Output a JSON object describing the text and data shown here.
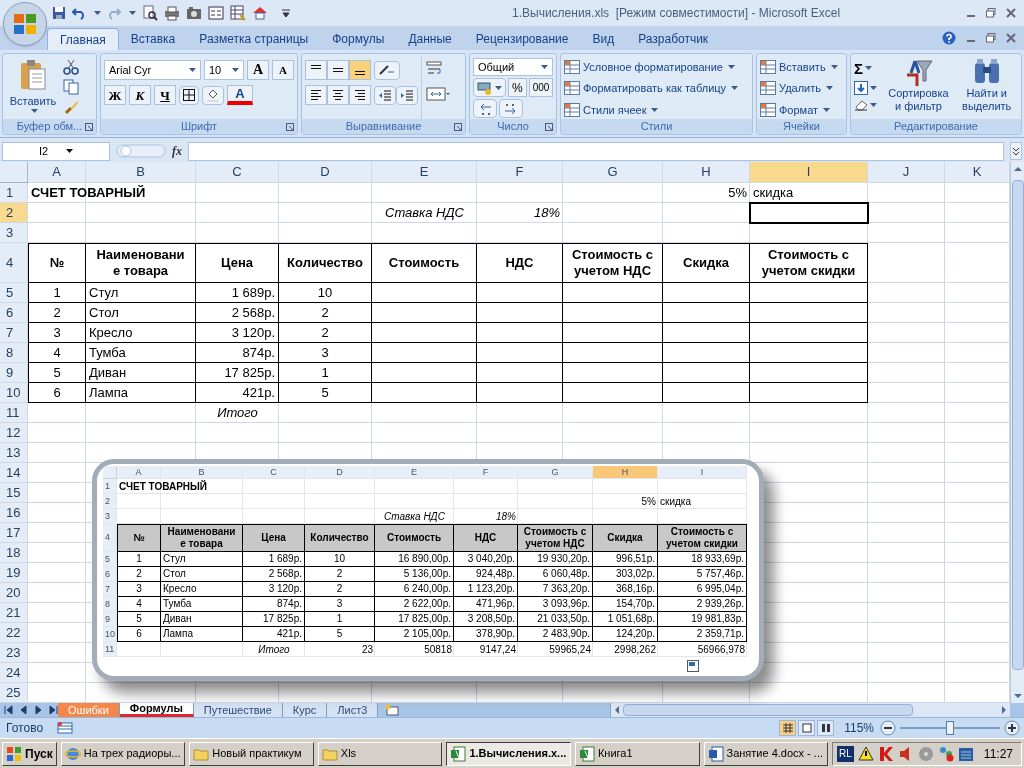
{
  "window": {
    "title": "1.Вычисления.xls  [Режим совместимости] - Microsoft Excel"
  },
  "ribbon": {
    "tabs": [
      {
        "label": "Главная",
        "selected": true
      },
      {
        "label": "Вставка",
        "selected": false
      },
      {
        "label": "Разметка страницы",
        "selected": false
      },
      {
        "label": "Формулы",
        "selected": false
      },
      {
        "label": "Данные",
        "selected": false
      },
      {
        "label": "Рецензирование",
        "selected": false
      },
      {
        "label": "Вид",
        "selected": false
      },
      {
        "label": "Разработчик",
        "selected": false
      }
    ],
    "groups": [
      {
        "kind": "clipboard",
        "label": "Буфер обм...",
        "paste": "Вставить"
      },
      {
        "kind": "font",
        "label": "Шрифт",
        "font_name": "Arial Cyr",
        "font_size": "10",
        "grow": "A",
        "shrink": "A",
        "bold": "Ж",
        "italic": "К",
        "underline": "Ч",
        "font_color": "A"
      },
      {
        "kind": "alignment",
        "label": "Выравнивание",
        "vertical_align": [
          {
            "selected": false
          },
          {
            "selected": false
          },
          {
            "selected": true
          }
        ]
      },
      {
        "kind": "number",
        "label": "Число",
        "format": "Общий",
        "percent": "%",
        "thousands": "000"
      },
      {
        "kind": "list",
        "label": "Стили",
        "items": [
          "Условное форматирование",
          "Форматировать как таблицу",
          "Стили ячеек"
        ]
      },
      {
        "kind": "list",
        "label": "Ячейки",
        "items": [
          "Вставить",
          "Удалить",
          "Формат"
        ]
      },
      {
        "kind": "editing",
        "label": "Редактирование",
        "sum": "Σ",
        "sort": "Сортировка и фильтр",
        "find": "Найти и выделить"
      }
    ]
  },
  "formula_bar": {
    "name_box": "I2",
    "fx": "fx"
  },
  "sheet": {
    "columns": [
      {
        "label": "A",
        "selected": false
      },
      {
        "label": "B",
        "selected": false
      },
      {
        "label": "C",
        "selected": false
      },
      {
        "label": "D",
        "selected": false
      },
      {
        "label": "E",
        "selected": false
      },
      {
        "label": "F",
        "selected": false
      },
      {
        "label": "G",
        "selected": false
      },
      {
        "label": "H",
        "selected": false
      },
      {
        "label": "I",
        "selected": true
      },
      {
        "label": "J",
        "selected": false
      },
      {
        "label": "K",
        "selected": false
      }
    ],
    "rows": [
      {
        "number": "1",
        "selected": false,
        "kind": "text",
        "cells": [
          "СЧЕТ ТОВАРНЫЙ",
          null,
          null,
          null,
          null,
          null,
          null,
          "5%",
          "скидка"
        ]
      },
      {
        "number": "2",
        "selected": true,
        "kind": "text",
        "cells": [
          null,
          null,
          null,
          null,
          "Ставка НДС",
          "18%"
        ]
      },
      {
        "number": "3",
        "selected": false,
        "kind": "text"
      },
      {
        "number": "4",
        "selected": false,
        "kind": "header",
        "cells": [
          "№",
          "Наименовани\nе товара",
          "Цена",
          "Количество",
          "Стоимость",
          "НДС",
          "Стоимость с\nучетом НДС",
          "Скидка",
          "Стоимость с\nучетом скидки"
        ]
      },
      {
        "number": "5",
        "selected": false,
        "kind": "item",
        "cells": [
          "1",
          "Стул",
          "1 689р.",
          "10"
        ]
      },
      {
        "number": "6",
        "selected": false,
        "kind": "item",
        "cells": [
          "2",
          "Стол",
          "2 568р.",
          "2"
        ]
      },
      {
        "number": "7",
        "selected": false,
        "kind": "item",
        "cells": [
          "3",
          "Кресло",
          "3 120р.",
          "2"
        ]
      },
      {
        "number": "8",
        "selected": false,
        "kind": "item",
        "cells": [
          "4",
          "Тумба",
          "874р.",
          "3"
        ]
      },
      {
        "number": "9",
        "selected": false,
        "kind": "item",
        "cells": [
          "5",
          "Диван",
          "17 825р.",
          "1"
        ]
      },
      {
        "number": "10",
        "selected": false,
        "kind": "item",
        "cells": [
          "6",
          "Лампа",
          "421р.",
          "5"
        ]
      },
      {
        "number": "11",
        "selected": false,
        "kind": "total",
        "cells": [
          null,
          null,
          "Итого"
        ]
      },
      {
        "number": "12",
        "selected": false,
        "kind": "text"
      },
      {
        "number": "13",
        "selected": false,
        "kind": "text"
      },
      {
        "number": "14",
        "selected": false,
        "kind": "text"
      },
      {
        "number": "15",
        "selected": false,
        "kind": "text"
      },
      {
        "number": "16",
        "selected": false,
        "kind": "text"
      },
      {
        "number": "17",
        "selected": false,
        "kind": "text"
      },
      {
        "number": "18",
        "selected": false,
        "kind": "text"
      },
      {
        "number": "19",
        "selected": false,
        "kind": "text"
      },
      {
        "number": "20",
        "selected": false,
        "kind": "text"
      },
      {
        "number": "21",
        "selected": false,
        "kind": "text"
      },
      {
        "number": "22",
        "selected": false,
        "kind": "text"
      },
      {
        "number": "23",
        "selected": false,
        "kind": "text"
      },
      {
        "number": "24",
        "selected": false,
        "kind": "text"
      },
      {
        "number": "25",
        "selected": false,
        "kind": "text"
      }
    ]
  },
  "embedded_image": {
    "columns": [
      {
        "label": "A",
        "selected": false
      },
      {
        "label": "B",
        "selected": false
      },
      {
        "label": "C",
        "selected": false
      },
      {
        "label": "D",
        "selected": false
      },
      {
        "label": "E",
        "selected": false
      },
      {
        "label": "F",
        "selected": false
      },
      {
        "label": "G",
        "selected": false
      },
      {
        "label": "H",
        "selected": true
      },
      {
        "label": "I",
        "selected": false
      }
    ],
    "rows": [
      {
        "number": "1",
        "selected": false,
        "kind": "text",
        "cells": [
          "СЧЕТ ТОВАРНЫЙ"
        ]
      },
      {
        "number": "2",
        "selected": false,
        "kind": "text",
        "cells": [
          null,
          null,
          null,
          null,
          null,
          null,
          null,
          "5%",
          "скидка"
        ]
      },
      {
        "number": "3",
        "selected": false,
        "kind": "text",
        "cells": [
          null,
          null,
          null,
          null,
          "Ставка НДС",
          "18%"
        ]
      },
      {
        "number": "4",
        "selected": false,
        "kind": "header",
        "cells": [
          "№",
          "Наименовани\nе товара",
          "Цена",
          "Количество",
          "Стоимость",
          "НДС",
          "Стоимость с\nучетом НДС",
          "Скидка",
          "Стоимость с\nучетом скидки"
        ]
      },
      {
        "number": "5",
        "selected": false,
        "kind": "item",
        "cells": [
          "1",
          "Стул",
          "1 689р.",
          "10",
          "16 890,00р.",
          "3 040,20р.",
          "19 930,20р.",
          "996,51р.",
          "18 933,69р."
        ]
      },
      {
        "number": "6",
        "selected": false,
        "kind": "item",
        "cells": [
          "2",
          "Стол",
          "2 568р.",
          "2",
          "5 136,00р.",
          "924,48р.",
          "6 060,48р.",
          "303,02р.",
          "5 757,46р."
        ]
      },
      {
        "number": "7",
        "selected": false,
        "kind": "item",
        "cells": [
          "3",
          "Кресло",
          "3 120р.",
          "2",
          "6 240,00р.",
          "1 123,20р.",
          "7 363,20р.",
          "368,16р.",
          "6 995,04р."
        ]
      },
      {
        "number": "8",
        "selected": false,
        "kind": "item",
        "cells": [
          "4",
          "Тумба",
          "874р.",
          "3",
          "2 622,00р.",
          "471,96р.",
          "3 093,96р.",
          "154,70р.",
          "2 939,26р."
        ]
      },
      {
        "number": "9",
        "selected": false,
        "kind": "item",
        "cells": [
          "5",
          "Диван",
          "17 825р.",
          "1",
          "17 825,00р.",
          "3 208,50р.",
          "21 033,50р.",
          "1 051,68р.",
          "19 981,83р."
        ]
      },
      {
        "number": "10",
        "selected": false,
        "kind": "item",
        "cells": [
          "6",
          "Лампа",
          "421р.",
          "5",
          "2 105,00р.",
          "378,90р.",
          "2 483,90р.",
          "124,20р.",
          "2 359,71р."
        ]
      },
      {
        "number": "11",
        "selected": false,
        "kind": "total",
        "cells": [
          null,
          null,
          "Итого",
          "23",
          "50818",
          "9147,24",
          "59965,24",
          "2998,262",
          "56966,978"
        ]
      }
    ]
  },
  "sheet_tabs": [
    {
      "label": "Ошибки",
      "selected": false,
      "color": "#f4884a"
    },
    {
      "label": "Формулы",
      "selected": true,
      "color": "#e02828"
    },
    {
      "label": "Путешествие",
      "selected": false
    },
    {
      "label": "Курс",
      "selected": false
    },
    {
      "label": "Лист3",
      "selected": false
    }
  ],
  "status_bar": {
    "status": "Готово",
    "views": [
      {
        "selected": true
      },
      {
        "selected": false
      },
      {
        "selected": false
      }
    ],
    "zoom": "115%",
    "zoom_slider": {
      "level": 0.5
    }
  },
  "taskbar": {
    "start": "Пуск",
    "tasks": [
      {
        "label": "На трех радиоры...",
        "kind": "browser",
        "selected": false
      },
      {
        "label": "Новый практикум",
        "kind": "folder",
        "selected": false
      },
      {
        "label": "Xls",
        "kind": "folder",
        "selected": false
      },
      {
        "label": "1.Вычисления.x...",
        "kind": "excel",
        "selected": true
      },
      {
        "label": "Книга1",
        "kind": "excel",
        "selected": false
      },
      {
        "label": "Занятие 4.docx - ...",
        "kind": "word",
        "selected": false
      }
    ],
    "language": "RL",
    "clock": "11:27"
  }
}
